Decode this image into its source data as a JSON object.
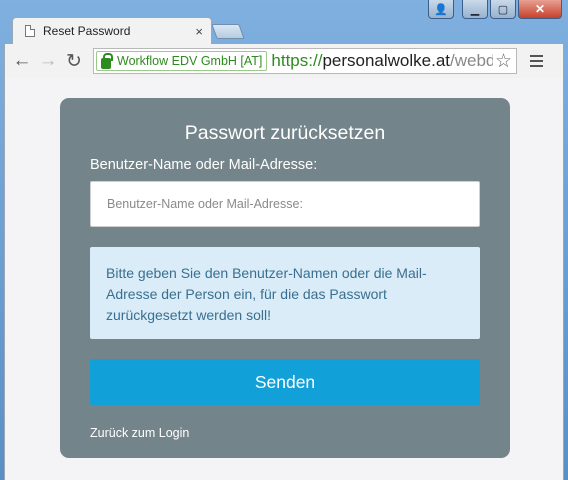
{
  "browser": {
    "tab_title": "Reset Password",
    "tab_close": "×",
    "ev_org": "Workflow EDV GmbH [AT]",
    "url_scheme": "https://",
    "url_host": "personalwolke.at",
    "url_path": "/webd",
    "back_glyph": "←",
    "forward_glyph": "→",
    "reload_glyph": "↻",
    "star_glyph": "☆",
    "win_min": "▁",
    "win_max": "▢",
    "win_close": "✕",
    "win_user": "👤"
  },
  "form": {
    "title": "Passwort zurücksetzen",
    "field_label": "Benutzer-Name oder Mail-Adresse:",
    "field_placeholder": "Benutzer-Name oder Mail-Adresse:",
    "field_value": "",
    "info_text": "Bitte geben Sie den Benutzer-Namen oder die Mail-Adresse der Person ein, für die das Passwort zurückgesetzt werden soll!",
    "submit_label": "Senden",
    "back_link": "Zurück zum Login"
  },
  "colors": {
    "card_bg": "#74848b",
    "button_bg": "#11a0d8",
    "info_bg": "#d9ecf7",
    "info_text": "#3a6f90",
    "secure_green": "#2e8b1f"
  },
  "icons": [
    "page-icon",
    "user-icon",
    "minimize-icon",
    "maximize-icon",
    "close-icon",
    "back-arrow-icon",
    "forward-arrow-icon",
    "reload-icon",
    "lock-icon",
    "star-icon",
    "menu-icon"
  ]
}
